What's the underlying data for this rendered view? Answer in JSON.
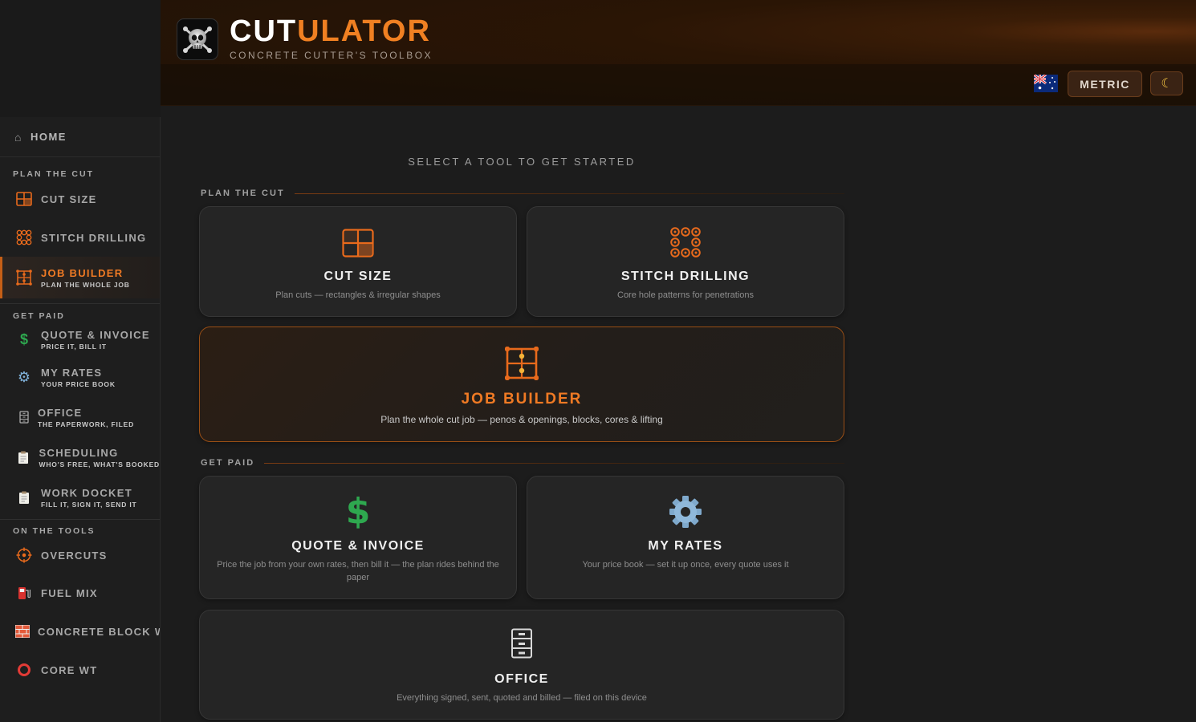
{
  "brand": {
    "title_white": "CUT",
    "title_orange": "ULATOR",
    "subtitle": "CONCRETE CUTTER'S TOOLBOX"
  },
  "header": {
    "units_label": "METRIC",
    "theme_icon": "moon-icon",
    "region_icon": "australia-flag-icon"
  },
  "sidebar": {
    "home": {
      "label": "HOME",
      "icon": "home-icon"
    },
    "sections": [
      {
        "label": "PLAN THE CUT",
        "items": [
          {
            "label": "CUT SIZE",
            "sub": "",
            "icon": "cut-grid-icon"
          },
          {
            "label": "STITCH DRILLING",
            "sub": "",
            "icon": "stitch-drill-icon"
          },
          {
            "label": "JOB BUILDER",
            "sub": "PLAN THE WHOLE JOB",
            "icon": "job-builder-icon",
            "active": true
          }
        ]
      },
      {
        "label": "GET PAID",
        "items": [
          {
            "label": "QUOTE & INVOICE",
            "sub": "PRICE IT, BILL IT",
            "icon": "dollar-icon"
          },
          {
            "label": "MY RATES",
            "sub": "YOUR PRICE BOOK",
            "icon": "gear-icon"
          },
          {
            "label": "OFFICE",
            "sub": "THE PAPERWORK, FILED",
            "icon": "file-cabinet-icon"
          },
          {
            "label": "SCHEDULING",
            "sub": "WHO'S FREE, WHAT'S BOOKED",
            "icon": "clipboard-icon"
          },
          {
            "label": "WORK DOCKET",
            "sub": "FILL IT, SIGN IT, SEND IT",
            "icon": "clipboard-icon"
          }
        ]
      },
      {
        "label": "ON THE TOOLS",
        "items": [
          {
            "label": "OVERCUTS",
            "sub": "",
            "icon": "crosshair-icon"
          },
          {
            "label": "FUEL MIX",
            "sub": "",
            "icon": "fuel-pump-icon"
          },
          {
            "label": "CONCRETE BLOCK W",
            "sub": "",
            "icon": "brick-icon"
          },
          {
            "label": "CORE WT",
            "sub": "",
            "icon": "ring-icon"
          }
        ]
      }
    ]
  },
  "main": {
    "prompt": "SELECT A TOOL TO GET STARTED",
    "groups": [
      {
        "label": "PLAN THE CUT"
      },
      {
        "label": "GET PAID"
      }
    ],
    "cards": [
      {
        "title": "CUT SIZE",
        "desc": "Plan cuts — rectangles & irregular shapes",
        "icon": "cut-grid-icon"
      },
      {
        "title": "STITCH DRILLING",
        "desc": "Core hole patterns for penetrations",
        "icon": "stitch-drill-icon"
      },
      {
        "title": "JOB BUILDER",
        "desc": "Plan the whole cut job — penos & openings, blocks, cores & lifting",
        "icon": "job-builder-icon"
      },
      {
        "title": "QUOTE & INVOICE",
        "desc": "Price the job from your own rates, then bill it — the plan rides behind the paper",
        "icon": "dollar-icon"
      },
      {
        "title": "MY RATES",
        "desc": "Your price book — set it up once, every quote uses it",
        "icon": "gear-icon"
      },
      {
        "title": "OFFICE",
        "desc": "Everything signed, sent, quoted and billed — filed on this device",
        "icon": "file-cabinet-icon"
      }
    ]
  }
}
